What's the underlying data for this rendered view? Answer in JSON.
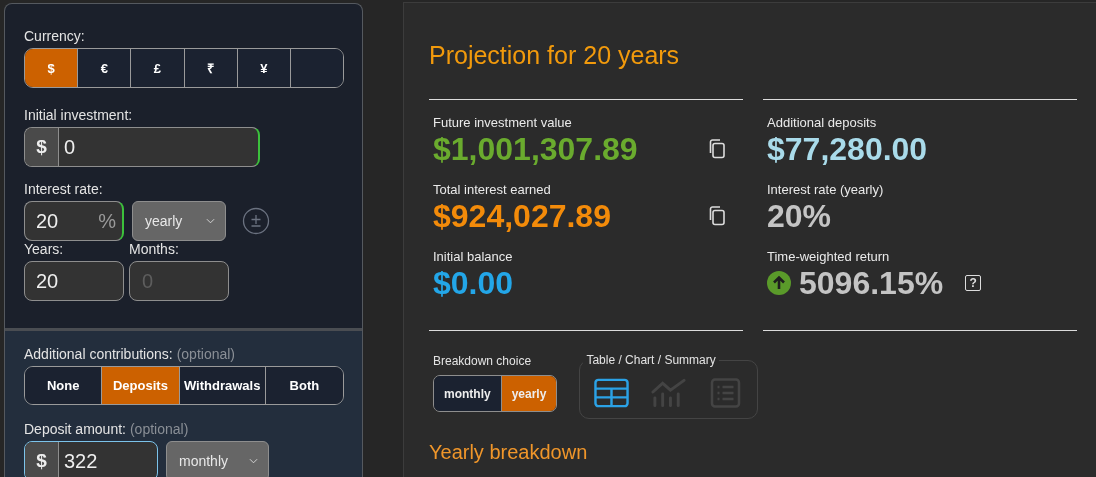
{
  "form": {
    "currency": {
      "label": "Currency:",
      "options": [
        {
          "symbol": "$",
          "selected": true
        },
        {
          "symbol": "€",
          "selected": false
        },
        {
          "symbol": "£",
          "selected": false
        },
        {
          "symbol": "₹",
          "selected": false
        },
        {
          "symbol": "¥",
          "selected": false
        }
      ]
    },
    "initial_investment": {
      "label": "Initial investment:",
      "prefix": "$",
      "value": "0",
      "valid": true
    },
    "interest_rate": {
      "label": "Interest rate:",
      "value": "20",
      "suffix": "%",
      "valid": true,
      "frequency": "yearly"
    },
    "years": {
      "label": "Years:",
      "value": "20"
    },
    "months": {
      "label": "Months:",
      "placeholder": "0"
    },
    "contributions": {
      "label": "Additional contributions:",
      "note": "(optional)",
      "options": [
        {
          "label": "None",
          "selected": false
        },
        {
          "label": "Deposits",
          "selected": true
        },
        {
          "label": "Withdrawals",
          "selected": false
        },
        {
          "label": "Both",
          "selected": false
        }
      ]
    },
    "deposit_amount": {
      "label": "Deposit amount:",
      "note": "(optional)",
      "prefix": "$",
      "value": "322",
      "focused": true,
      "frequency": "monthly"
    }
  },
  "results": {
    "title": "Projection for 20 years",
    "left_stats": [
      {
        "label": "Future investment value",
        "value": "$1,001,307.89",
        "color": "#6aab2e",
        "copyable": true
      },
      {
        "label": "Total interest earned",
        "value": "$924,027.89",
        "color": "#f38b0a",
        "copyable": true
      },
      {
        "label": "Initial balance",
        "value": "$0.00",
        "color": "#23a6e8",
        "copyable": false
      }
    ],
    "right_stats": [
      {
        "label": "Additional deposits",
        "value": "$77,280.00",
        "color": "#a9dbea",
        "trend_up": false
      },
      {
        "label": "Interest rate (yearly)",
        "value": "20%",
        "color": "#c4c4c4",
        "trend_up": false
      },
      {
        "label": "Time-weighted return",
        "value": "5096.15%",
        "color": "#c4c4c4",
        "trend_up": true,
        "help": "?"
      }
    ],
    "breakdown": {
      "label": "Breakdown choice",
      "options": [
        {
          "label": "monthly",
          "selected": false
        },
        {
          "label": "yearly",
          "selected": true
        }
      ]
    },
    "view": {
      "label": "Table / Chart / Summary",
      "options": [
        {
          "kind": "table",
          "selected": true
        },
        {
          "kind": "chart",
          "selected": false
        },
        {
          "kind": "summary",
          "selected": false
        }
      ]
    },
    "section_title": "Yearly breakdown"
  }
}
